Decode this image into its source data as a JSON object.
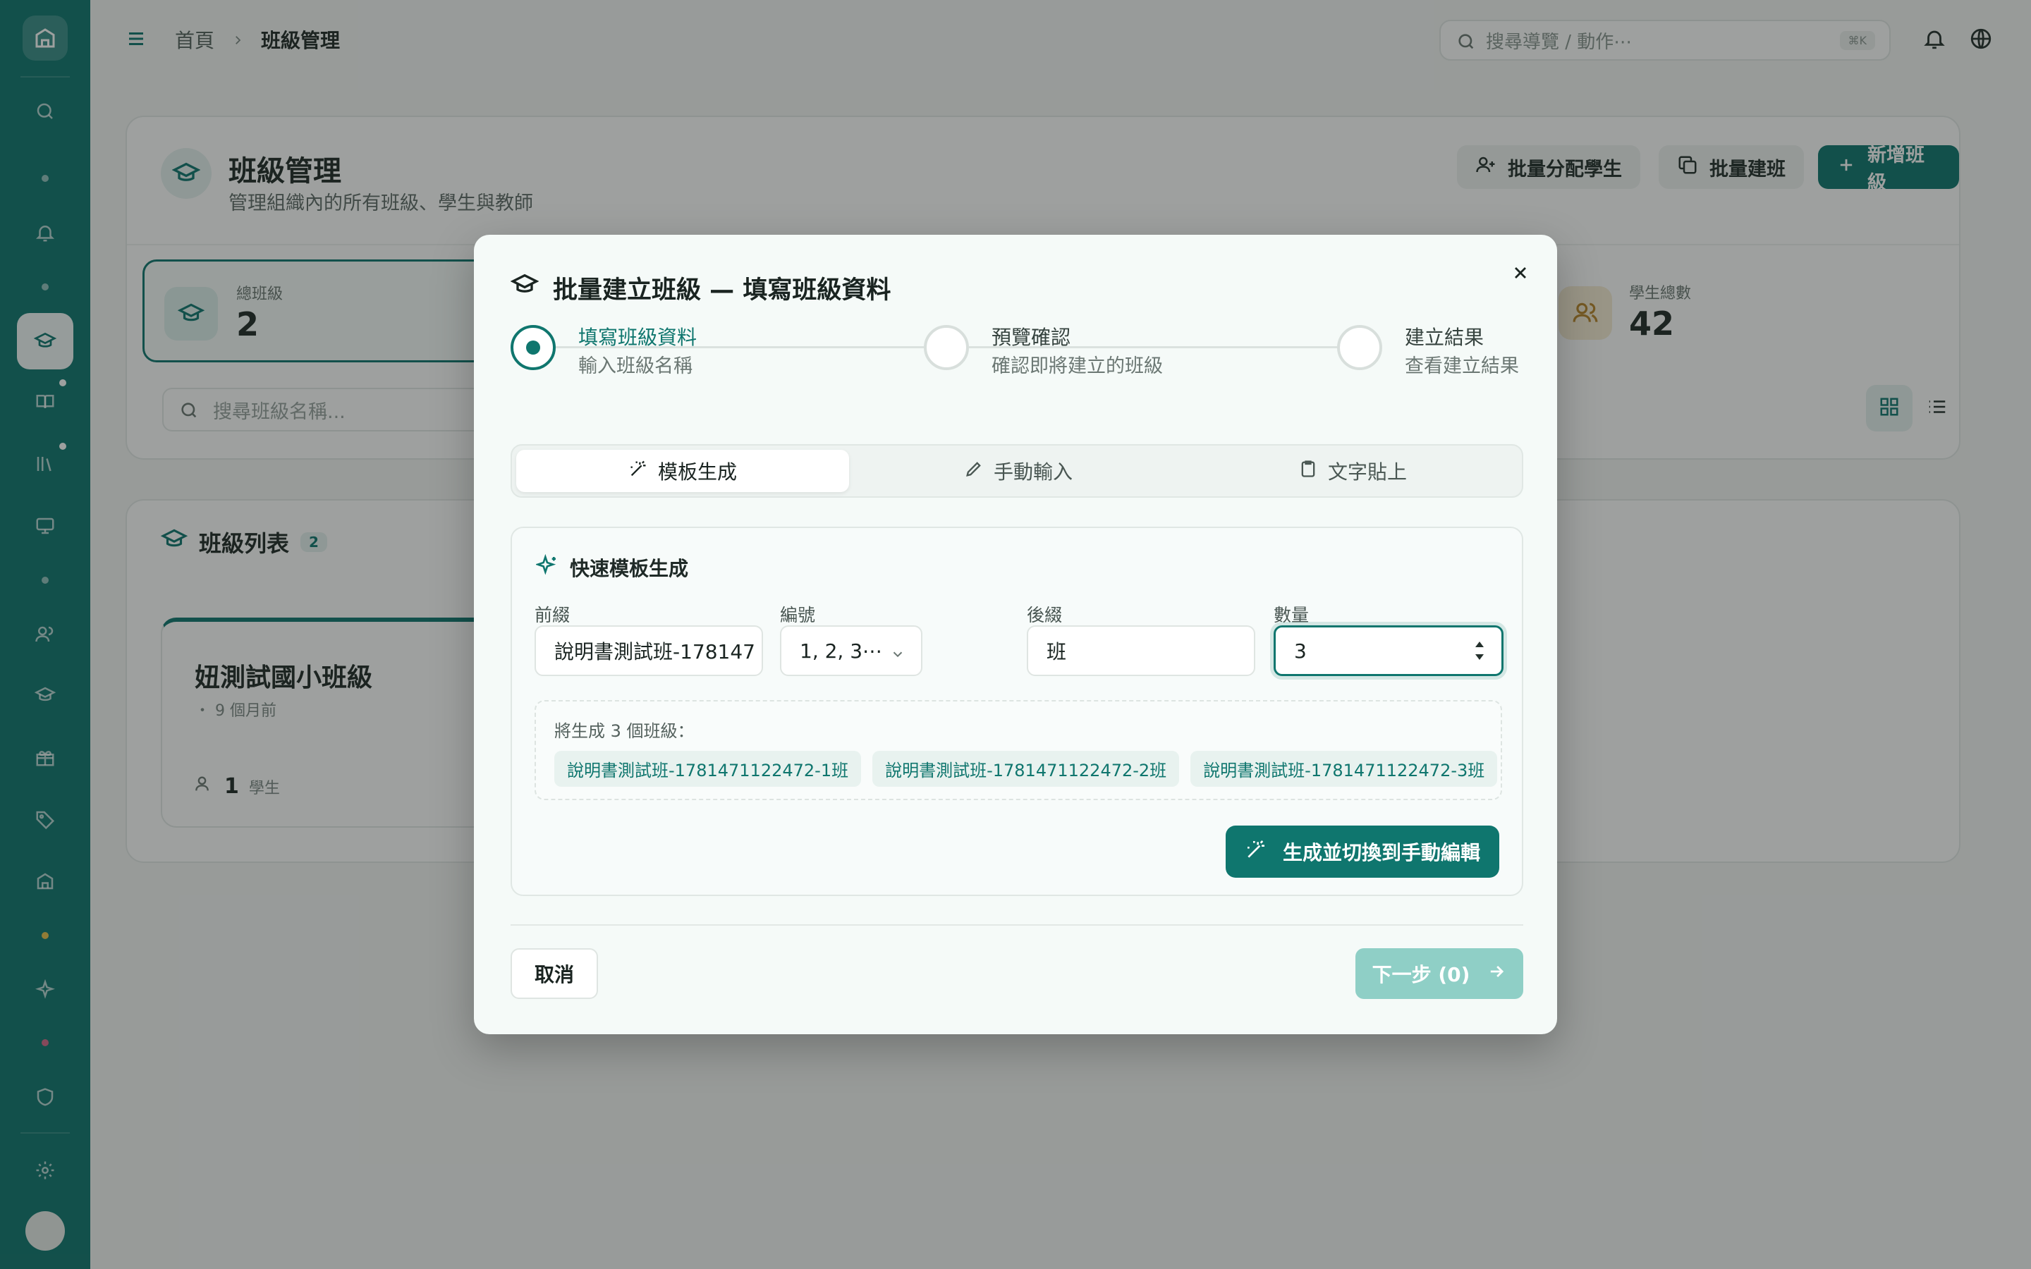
{
  "colors": {
    "accent": "#0f766e",
    "accent_soft": "#e6f1ef",
    "overlay": "rgba(24,28,27,0.42)",
    "disabled_button": "#8fcfc6"
  },
  "topbar": {
    "breadcrumb_home": "首頁",
    "breadcrumb_current": "班級管理",
    "search_placeholder": "搜尋導覽 / 動作⋯",
    "search_shortcut": "⌘K",
    "icons": [
      "menu-icon",
      "search-icon",
      "bell-icon",
      "globe-icon"
    ]
  },
  "sidebar": {
    "icons": [
      "logo-icon",
      "search-icon",
      "bell-icon",
      "graduation-cap-icon",
      "book-icon",
      "library-icon",
      "monitor-icon",
      "users-icon",
      "graduation-cap-icon",
      "gift-icon",
      "tag-icon",
      "school-icon",
      "sparkle-icon",
      "shield-icon",
      "gear-icon",
      "avatar"
    ],
    "active_item": "graduation-cap-icon"
  },
  "header": {
    "title": "班級管理",
    "subtitle": "管理組織內的所有班級、學生與教師",
    "btn_assign": "批量分配學生",
    "btn_batch": "批量建班",
    "btn_new": "新增班級"
  },
  "stats": {
    "total_classes_label": "總班級",
    "total_classes_value": "2",
    "total_students_label": "學生總數",
    "total_students_value": "42"
  },
  "page_search": {
    "placeholder": "搜尋班級名稱..."
  },
  "class_list": {
    "title": "班級列表",
    "count": "2",
    "card": {
      "name": "妞測試國小班級",
      "time": "・ 9 個月前",
      "student_count": "1",
      "student_unit": "學生"
    }
  },
  "modal": {
    "title": "批量建立班級 — 填寫班級資料",
    "steps": [
      {
        "title": "填寫班級資料",
        "subtitle": "輸入班級名稱"
      },
      {
        "title": "預覽確認",
        "subtitle": "確認即將建立的班級"
      },
      {
        "title": "建立結果",
        "subtitle": "查看建立結果"
      }
    ],
    "active_step": 0,
    "tabs": [
      {
        "label": "模板生成"
      },
      {
        "label": "手動輸入"
      },
      {
        "label": "文字貼上"
      }
    ],
    "active_tab": 0,
    "panel": {
      "title": "快速模板生成",
      "prefix_label": "前綴",
      "prefix_value": "說明書測試班-178147",
      "numbering_label": "編號",
      "numbering_value": "1, 2, 3⋯",
      "suffix_label": "後綴",
      "suffix_value": "班",
      "quantity_label": "數量",
      "quantity_value": "3",
      "preview_label": "將生成 3 個班級：",
      "preview_items": [
        "說明書測試班-1781471122472-1班",
        "說明書測試班-1781471122472-2班",
        "說明書測試班-1781471122472-3班"
      ],
      "generate_button": "生成並切換到手動編輯"
    },
    "cancel_button": "取消",
    "next_button": "下一步 (0)"
  }
}
